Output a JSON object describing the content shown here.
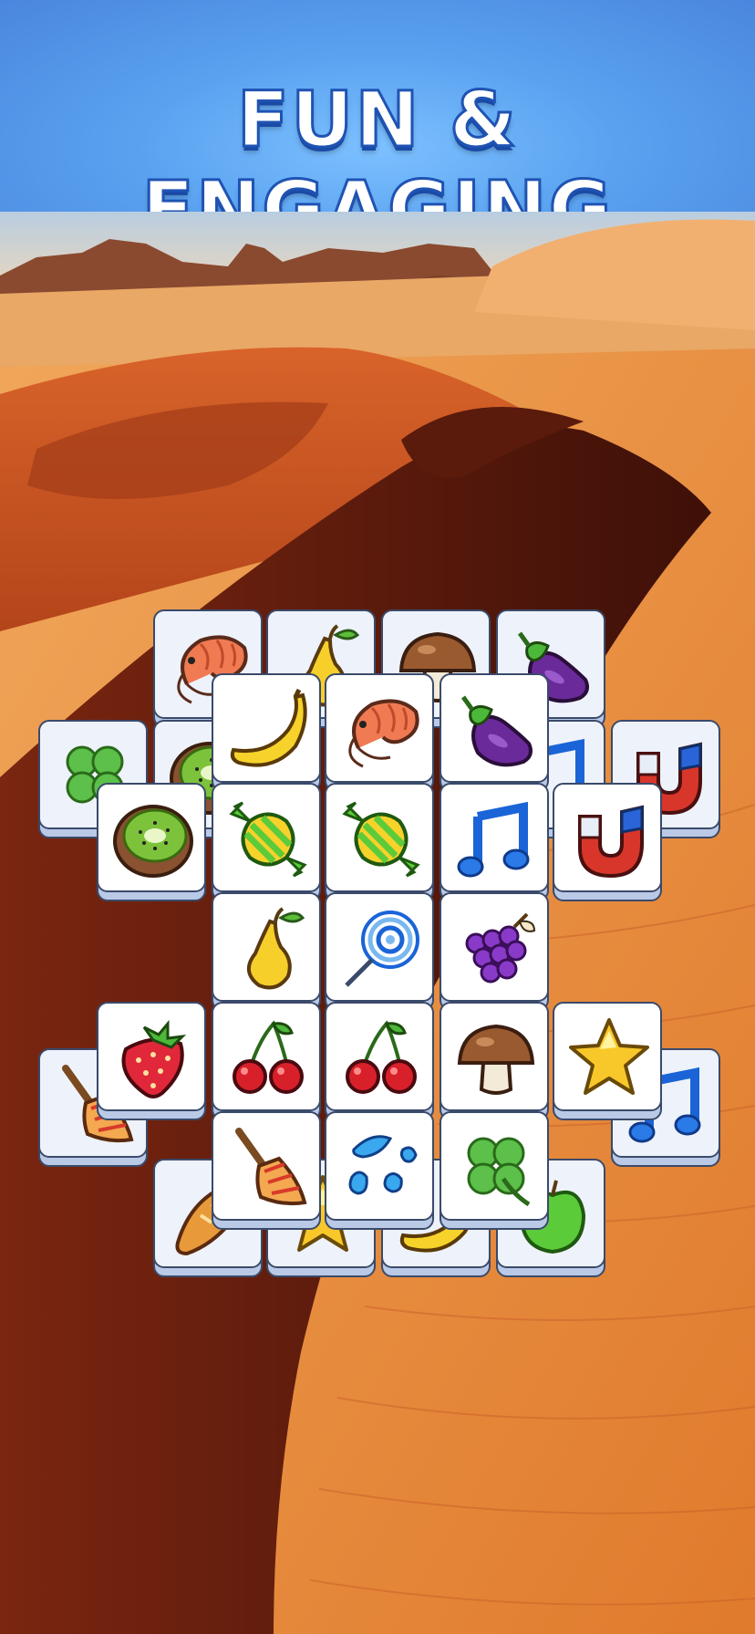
{
  "banner": {
    "title": "FUN & ENGAGING",
    "gradient_colors": [
      "#7cc0ff",
      "#5aa2f0",
      "#4a86dd"
    ],
    "title_color": "#ffffff",
    "outline_color": "#1f53b3"
  },
  "background": {
    "scene": "desert-dunes",
    "colors": {
      "sky": "#c9d9ea",
      "sand": "#e89a4a",
      "shadow": "#4a160c"
    }
  },
  "tiles": [
    {
      "icon": "shrimp-icon",
      "layer": "back"
    },
    {
      "icon": "pear-icon",
      "layer": "back"
    },
    {
      "icon": "mushroom-icon",
      "layer": "back"
    },
    {
      "icon": "eggplant-icon",
      "layer": "back"
    },
    {
      "icon": "clover-icon",
      "layer": "back"
    },
    {
      "icon": "kiwi-icon",
      "layer": "back"
    },
    {
      "icon": "music-note-icon",
      "layer": "back"
    },
    {
      "icon": "magnet-icon",
      "layer": "back"
    },
    {
      "icon": "broom-icon",
      "layer": "back"
    },
    {
      "icon": "music-note-icon",
      "layer": "back"
    },
    {
      "icon": "bread-icon",
      "layer": "back"
    },
    {
      "icon": "star-icon",
      "layer": "back"
    },
    {
      "icon": "banana-icon",
      "layer": "back"
    },
    {
      "icon": "apple-icon",
      "layer": "back"
    },
    {
      "icon": "banana-icon",
      "layer": "front"
    },
    {
      "icon": "shrimp-icon",
      "layer": "front"
    },
    {
      "icon": "eggplant-icon",
      "layer": "front"
    },
    {
      "icon": "kiwi-icon",
      "layer": "front"
    },
    {
      "icon": "candy-icon",
      "layer": "front"
    },
    {
      "icon": "candy-icon",
      "layer": "front"
    },
    {
      "icon": "music-note-icon",
      "layer": "front"
    },
    {
      "icon": "magnet-icon",
      "layer": "front"
    },
    {
      "icon": "pear-icon",
      "layer": "front"
    },
    {
      "icon": "lollipop-icon",
      "layer": "front"
    },
    {
      "icon": "grapes-icon",
      "layer": "front"
    },
    {
      "icon": "strawberry-icon",
      "layer": "front"
    },
    {
      "icon": "cherry-icon",
      "layer": "front"
    },
    {
      "icon": "cherry-icon",
      "layer": "front"
    },
    {
      "icon": "mushroom-icon",
      "layer": "front"
    },
    {
      "icon": "star-icon",
      "layer": "front"
    },
    {
      "icon": "broom-icon",
      "layer": "front"
    },
    {
      "icon": "water-drops-icon",
      "layer": "front"
    },
    {
      "icon": "clover-icon",
      "layer": "front"
    }
  ]
}
